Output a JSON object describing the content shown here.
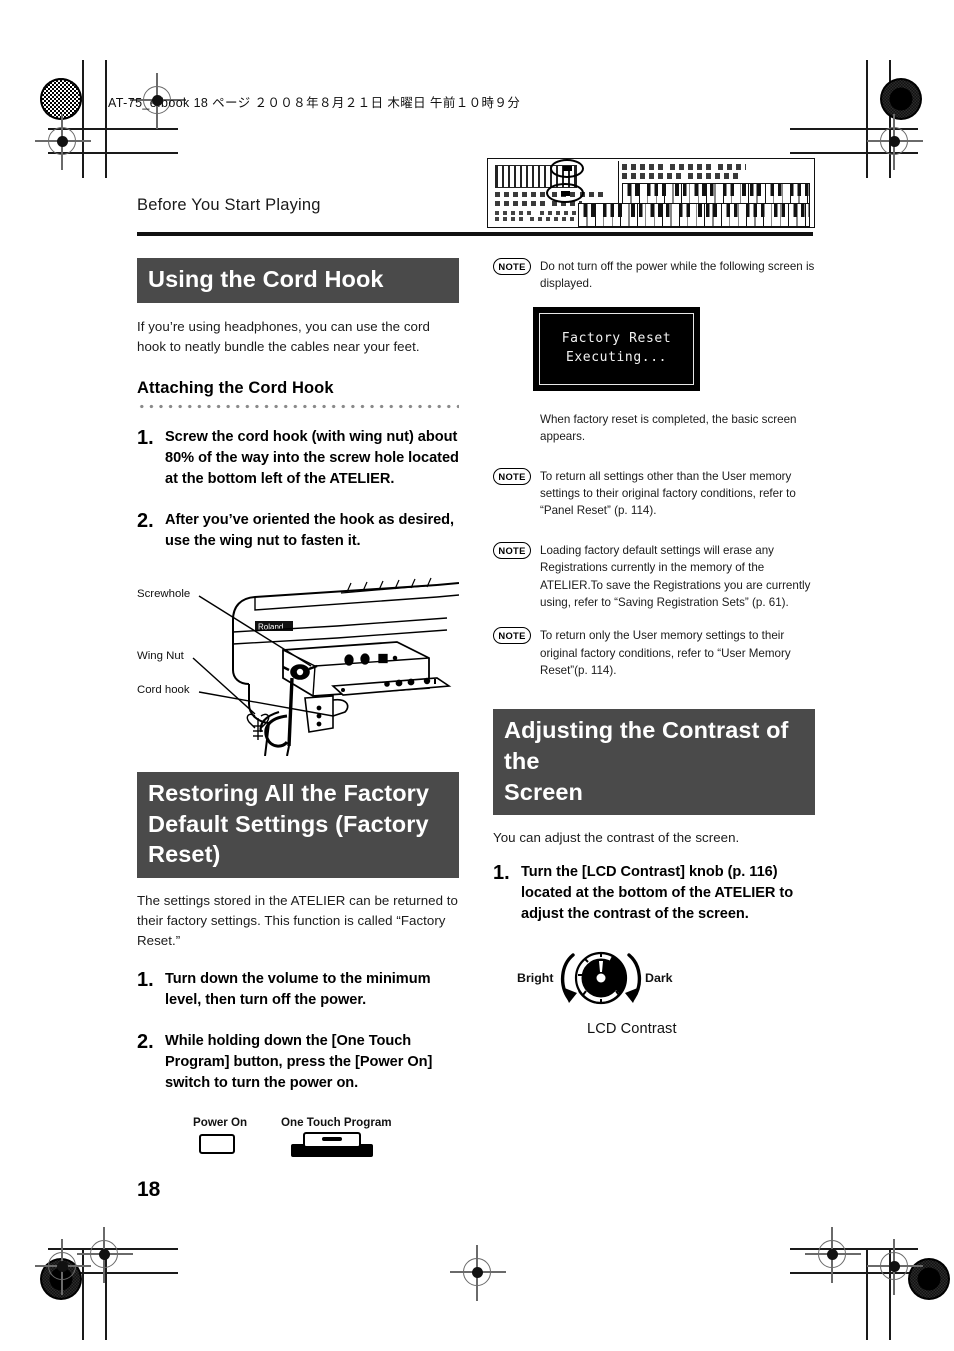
{
  "print_slug": "AT-75_e.book  18 ページ  ２００８年８月２１日   木曜日   午前１０時９分",
  "running_head": "Before You Start Playing",
  "page_number": "18",
  "colors": {
    "section_bar": "#4a4a4a",
    "section_bar_text": "#ffffff",
    "rule": "#111111",
    "lcd_background": "#000000",
    "lcd_text": "#f2f2f2"
  },
  "left_column": {
    "section1": {
      "title": "Using the Cord Hook",
      "intro": "If you’re using headphones, you can use the cord hook to neatly bundle the cables near your feet.",
      "subhead": "Attaching the Cord Hook",
      "steps": [
        {
          "num": "1.",
          "text": "Screw the cord hook (with wing nut) about 80% of the way into the screw hole located at the bottom left of the ATELIER."
        },
        {
          "num": "2.",
          "text": "After you’ve oriented the hook as desired, use the wing nut to fasten it."
        }
      ],
      "illustration": {
        "name": "atelier-underside-diagram",
        "brand_mark": "Roland",
        "callouts": [
          {
            "label": "Screwhole"
          },
          {
            "label": "Wing Nut"
          },
          {
            "label": "Cord hook"
          }
        ]
      }
    },
    "section2": {
      "title_line1": "Restoring All the Factory",
      "title_line2": "Default Settings (Factory Reset)",
      "intro": "The settings stored in the ATELIER can be returned to their factory settings. This function is called “Factory Reset.”",
      "steps": [
        {
          "num": "1.",
          "text": "Turn down the volume to the minimum level, then turn off the power."
        },
        {
          "num": "2.",
          "text": "While holding down the [One Touch Program] button, press the [Power On] switch to turn the power on."
        }
      ],
      "button_figure": {
        "power_label": "Power On",
        "otp_label": "One Touch Program"
      }
    }
  },
  "right_column": {
    "note1": {
      "badge": "NOTE",
      "text": "Do not turn off the power while the following screen is displayed."
    },
    "lcd": {
      "line1": "Factory Reset",
      "line2": "Executing..."
    },
    "after_lcd_text": "When factory reset is completed, the basic screen appears.",
    "note2": {
      "badge": "NOTE",
      "text": "To return all settings other than the User memory settings to their original factory conditions, refer to “Panel Reset” (p. 114)."
    },
    "note3": {
      "badge": "NOTE",
      "text": "Loading factory default settings will erase any Registrations currently in the memory of the ATELIER.To save the Registrations you are currently using, refer to “Saving Registration Sets” (p. 61)."
    },
    "note4": {
      "badge": "NOTE",
      "text": "To return only the User memory settings to their original factory conditions, refer to “User Memory Reset”(p. 114)."
    },
    "section3": {
      "title_line1": "Adjusting the Contrast of the",
      "title_line2": "Screen",
      "intro": "You can adjust the contrast of the screen.",
      "steps": [
        {
          "num": "1.",
          "text": "Turn the [LCD Contrast] knob (p. 116) located at the bottom of the ATELIER to adjust the contrast of the screen."
        }
      ],
      "knob_figure": {
        "left_label": "Bright",
        "right_label": "Dark",
        "caption": "LCD Contrast"
      }
    }
  }
}
